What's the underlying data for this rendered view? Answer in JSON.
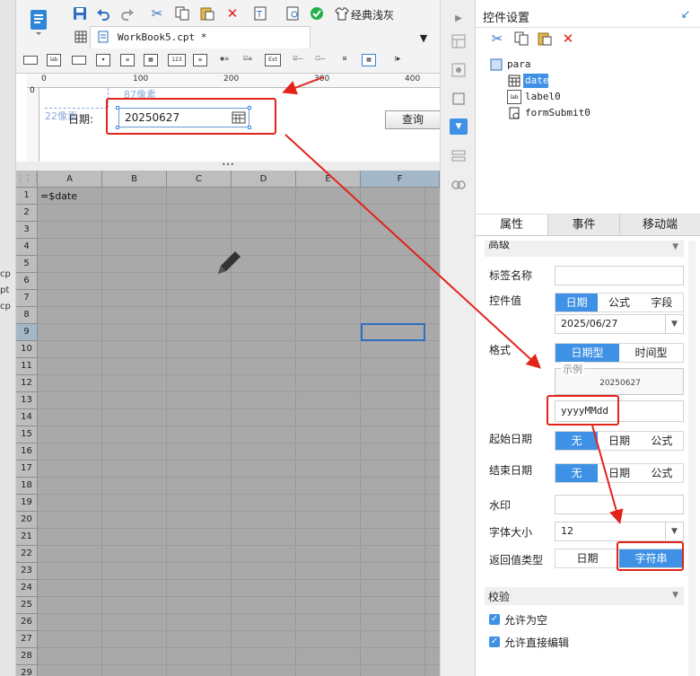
{
  "left_fragments": [
    "cp",
    "pt",
    "cp"
  ],
  "toolbar": {
    "classic_gray": "经典浅灰"
  },
  "tab": {
    "title": "WorkBook5.cpt *"
  },
  "widget_icons": [
    "lab",
    "123",
    "Ext"
  ],
  "ruler": {
    "labels": [
      "0",
      "100",
      "200",
      "300",
      "400"
    ],
    "px_hint": "87像素",
    "vpx_hint": "22像素",
    "v0": "0"
  },
  "form": {
    "date_label": "日期:",
    "date_value": "20250627",
    "query_button": "查询"
  },
  "sheet": {
    "columns": [
      "A",
      "B",
      "C",
      "D",
      "E",
      "F"
    ],
    "rows": [
      "1",
      "2",
      "3",
      "4",
      "5",
      "6",
      "7",
      "8",
      "9",
      "10",
      "11",
      "12",
      "13",
      "14",
      "15",
      "16",
      "17",
      "18",
      "19",
      "20",
      "21",
      "22",
      "23",
      "24",
      "25",
      "26",
      "27",
      "28",
      "29"
    ],
    "a1_value": "=$date",
    "corner": "⋮⋮⋮",
    "splitter": "•••"
  },
  "panel": {
    "title": "控件设置",
    "tree": {
      "root": "para",
      "items": [
        "date",
        "label0",
        "formSubmit0"
      ]
    },
    "tabs": [
      "属性",
      "事件",
      "移动端"
    ],
    "section_advanced": "高级",
    "tag_name_label": "标签名称",
    "control_value_label": "控件值",
    "control_value_options": [
      "日期",
      "公式",
      "字段"
    ],
    "date_default": "2025/06/27",
    "format_label": "格式",
    "format_type_options": [
      "日期型",
      "时间型"
    ],
    "example_label": "示例",
    "example_value": "20250627",
    "format_pattern": "yyyyMMdd",
    "start_date_label": "起始日期",
    "end_date_label": "结束日期",
    "range_options": [
      "无",
      "日期",
      "公式"
    ],
    "watermark_label": "水印",
    "font_size_label": "字体大小",
    "font_size_value": "12",
    "return_type_label": "返回值类型",
    "return_type_options": [
      "日期",
      "字符串"
    ],
    "section_validate": "校验",
    "allow_empty": "允许为空",
    "allow_direct_edit": "允许直接编辑"
  },
  "colors": {
    "accent": "#3e91e4",
    "annotation_red": "#e2231a",
    "sheet_gray": "#a9a9a9"
  }
}
